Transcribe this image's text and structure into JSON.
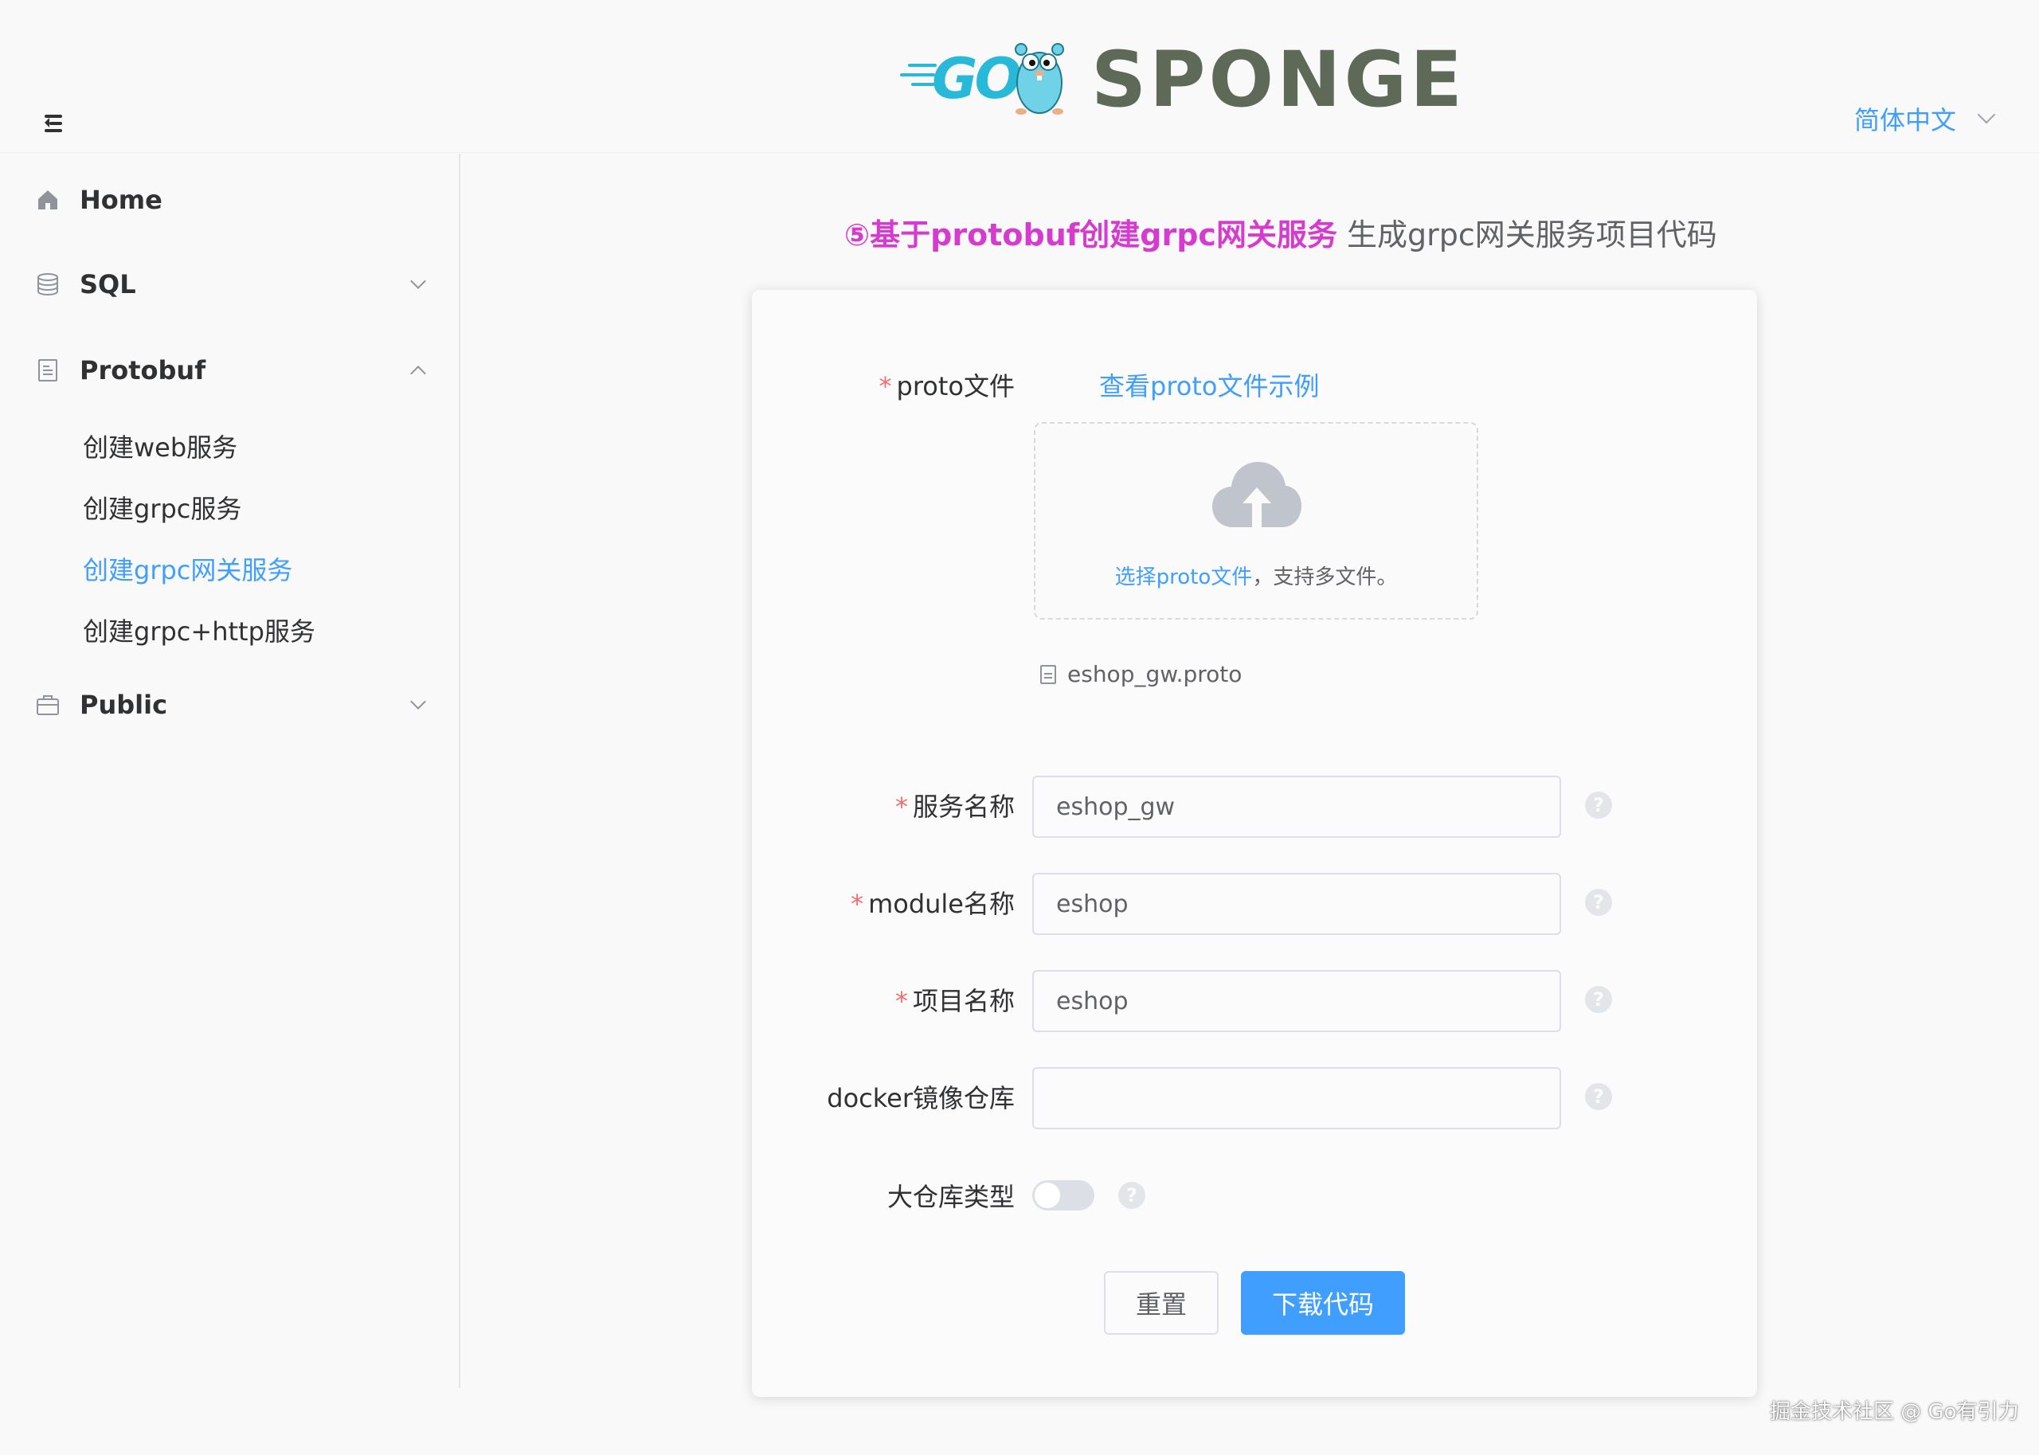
{
  "header": {
    "logo_go": "GO",
    "logo_sponge": "SPONGE",
    "language": "简体中文"
  },
  "sidebar": {
    "items": [
      {
        "label": "Home",
        "icon": "home-icon"
      },
      {
        "label": "SQL",
        "icon": "database-icon",
        "expanded": false
      },
      {
        "label": "Protobuf",
        "icon": "document-icon",
        "expanded": true,
        "children": [
          {
            "label": "创建web服务",
            "active": false
          },
          {
            "label": "创建grpc服务",
            "active": false
          },
          {
            "label": "创建grpc网关服务",
            "active": true
          },
          {
            "label": "创建grpc+http服务",
            "active": false
          }
        ]
      },
      {
        "label": "Public",
        "icon": "briefcase-icon",
        "expanded": false
      }
    ]
  },
  "main": {
    "title_highlight": "⑤基于protobuf创建grpc网关服务",
    "title_rest": " 生成grpc网关服务项目代码",
    "form": {
      "proto_label": "proto文件",
      "proto_example_link": "查看proto文件示例",
      "upload_link": "选择proto文件",
      "upload_hint": "，支持多文件。",
      "uploaded_file": "eshop_gw.proto",
      "service_name_label": "服务名称",
      "service_name_value": "eshop_gw",
      "module_name_label": "module名称",
      "module_name_value": "eshop",
      "project_name_label": "项目名称",
      "project_name_value": "eshop",
      "docker_repo_label": "docker镜像仓库",
      "docker_repo_value": "",
      "monorepo_label": "大仓库类型",
      "monorepo_enabled": false,
      "required_mark": "*",
      "help_mark": "?"
    },
    "buttons": {
      "reset": "重置",
      "download": "下载代码"
    }
  },
  "watermark": "掘金技术社区 @ Go有引力",
  "colors": {
    "accent": "#409eff",
    "title_highlight": "#d63bd0",
    "required": "#f56c6c"
  }
}
